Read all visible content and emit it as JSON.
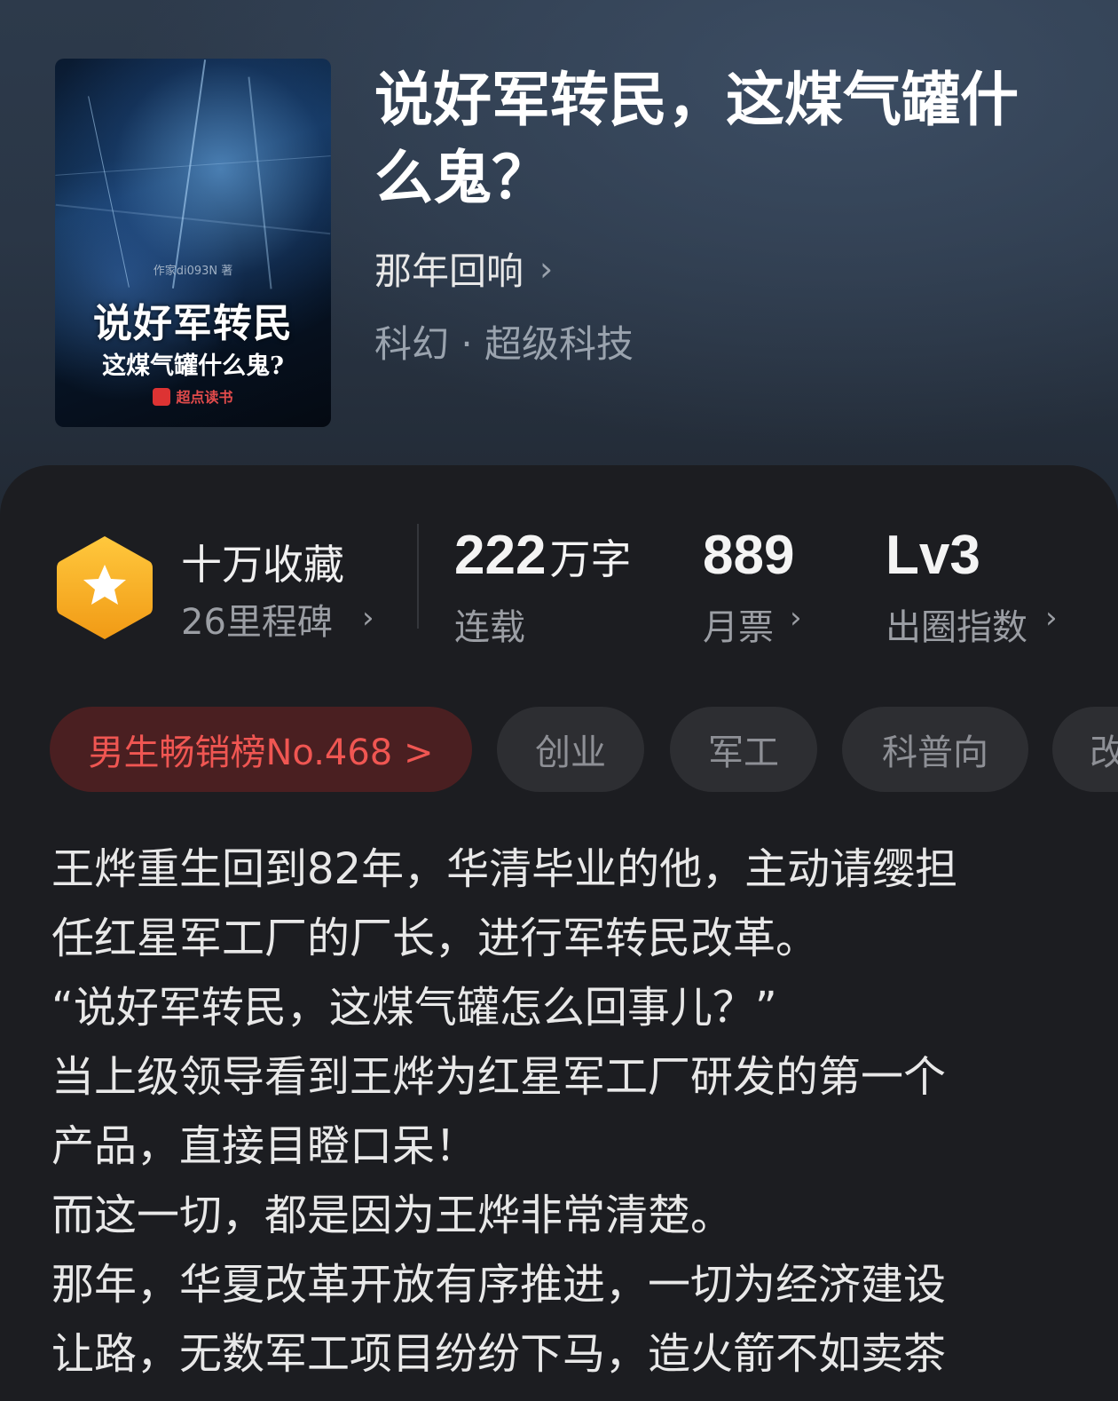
{
  "book": {
    "title": "说好军转民，这煤气罐什么鬼？",
    "author": "那年回响",
    "genre": "科幻 · 超级科技",
    "cover": {
      "author_credit": "作家di093N 著",
      "title_line1": "说好军转民",
      "title_line2": "这煤气罐什么鬼?",
      "publisher": "超点读书"
    }
  },
  "stats": {
    "collection_title": "十万收藏",
    "collection_sub": "26里程碑",
    "words_value": "222",
    "words_unit": "万字",
    "words_label": "连载",
    "votes_value": "889",
    "votes_label": "月票",
    "index_value": "Lv3",
    "index_label": "出圈指数"
  },
  "tags": [
    "男生畅销榜No.468 >",
    "创业",
    "军工",
    "科普向",
    "改"
  ],
  "description": [
    "王烨重生回到82年，华清毕业的他，主动请缨担",
    "任红星军工厂的厂长，进行军转民改革。",
    "“说好军转民，这煤气罐怎么回事儿？”",
    "当上级领导看到王烨为红星军工厂研发的第一个",
    "产品，直接目瞪口呆！",
    "而这一切，都是因为王烨非常清楚。",
    "那年，华夏改革开放有序推进，一切为经济建设",
    "让路，无数军工项目纷纷下马，造火箭不如卖茶"
  ],
  "colors": {
    "badge_gold": "#f6b026",
    "rank_text": "#f05652",
    "rank_bg": "#4a1f21"
  },
  "icons": {
    "badge": "star-hexagon-icon",
    "chevron": "chevron-right-icon"
  }
}
